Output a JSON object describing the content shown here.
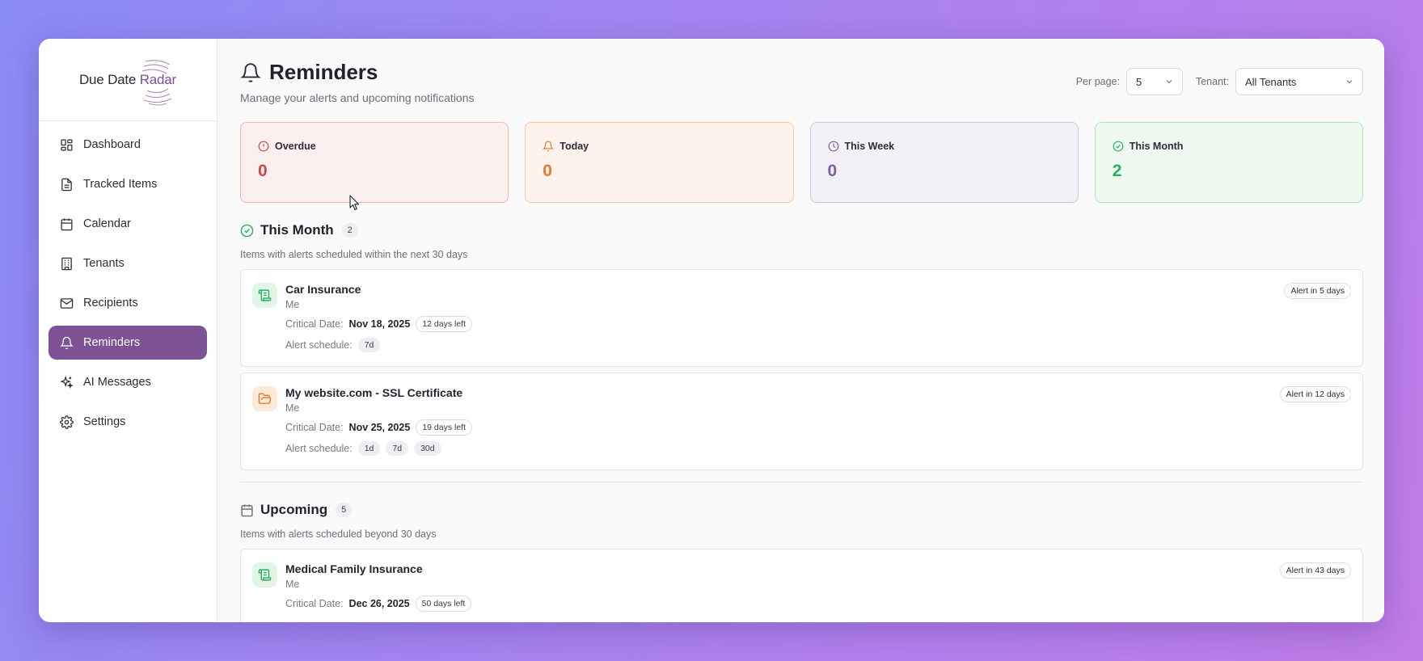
{
  "logo": {
    "part1": "Due Date ",
    "part2": "Radar"
  },
  "sidebar": {
    "items": [
      {
        "label": "Dashboard",
        "icon": "dashboard-icon"
      },
      {
        "label": "Tracked Items",
        "icon": "document-icon"
      },
      {
        "label": "Calendar",
        "icon": "calendar-icon"
      },
      {
        "label": "Tenants",
        "icon": "building-icon"
      },
      {
        "label": "Recipients",
        "icon": "mail-icon"
      },
      {
        "label": "Reminders",
        "icon": "bell-icon",
        "active": true
      },
      {
        "label": "AI Messages",
        "icon": "sparkles-icon"
      },
      {
        "label": "Settings",
        "icon": "gear-icon"
      }
    ]
  },
  "header": {
    "title": "Reminders",
    "subtitle": "Manage your alerts and upcoming notifications",
    "per_page_label": "Per page:",
    "per_page_value": "5",
    "tenant_label": "Tenant:",
    "tenant_value": "All Tenants"
  },
  "stats": {
    "overdue": {
      "label": "Overdue",
      "value": "0",
      "color": "#d04646"
    },
    "today": {
      "label": "Today",
      "value": "0",
      "color": "#e77a2e"
    },
    "week": {
      "label": "This Week",
      "value": "0",
      "color": "#7c5f9c"
    },
    "month": {
      "label": "This Month",
      "value": "2",
      "color": "#2bae5e"
    }
  },
  "sections": {
    "this_month": {
      "title": "This Month",
      "count": "2",
      "description": "Items with alerts scheduled within the next 30 days",
      "items": [
        {
          "name": "Car Insurance",
          "owner": "Me",
          "critical_label": "Critical Date:",
          "date": "Nov 18, 2025",
          "days_left": "12 days left",
          "schedule_label": "Alert schedule:",
          "schedule": [
            "7d"
          ],
          "alert": "Alert in 5 days",
          "icon": "scroll-icon"
        },
        {
          "name": "My website.com - SSL Certificate",
          "owner": "Me",
          "critical_label": "Critical Date:",
          "date": "Nov 25, 2025",
          "days_left": "19 days left",
          "schedule_label": "Alert schedule:",
          "schedule": [
            "1d",
            "7d",
            "30d"
          ],
          "alert": "Alert in 12 days",
          "icon": "folder-open-icon"
        }
      ]
    },
    "upcoming": {
      "title": "Upcoming",
      "count": "5",
      "description": "Items with alerts scheduled beyond 30 days",
      "items": [
        {
          "name": "Medical Family Insurance",
          "owner": "Me",
          "critical_label": "Critical Date:",
          "date": "Dec 26, 2025",
          "days_left": "50 days left",
          "alert": "Alert in 43 days",
          "icon": "scroll-icon"
        }
      ]
    }
  }
}
